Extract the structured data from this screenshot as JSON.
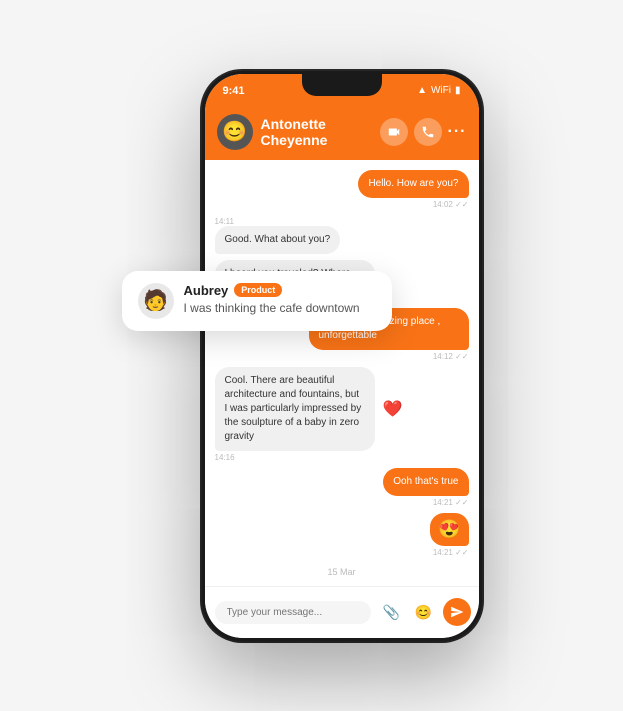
{
  "status_bar": {
    "time": "9:41",
    "signal": "●●●",
    "wifi": "▲",
    "battery": "▮"
  },
  "header": {
    "name": "Antonette Cheyenne",
    "avatar_emoji": "😊",
    "video_icon": "video",
    "phone_icon": "phone",
    "more_label": "···"
  },
  "messages": [
    {
      "id": 1,
      "type": "sent",
      "text": "Hello. How are you?",
      "time": "14:02",
      "read": true
    },
    {
      "id": 2,
      "type": "received",
      "text": "Good. What about you?",
      "time": "14:11"
    },
    {
      "id": 3,
      "type": "received",
      "text": "I heard you traveled? Where did you go this time?",
      "time": ""
    },
    {
      "id": 4,
      "type": "sent",
      "text": "Singapore. Amazing place , unforgettable",
      "time": "14:12",
      "read": true
    },
    {
      "id": 5,
      "type": "received",
      "text": "Cool. There are beautiful architecture and fountains, but I was particularly impressed by the soulpture of a baby in zero gravity",
      "time": "14:16",
      "has_heart": true
    },
    {
      "id": 6,
      "type": "sent",
      "text": "Ooh that's true",
      "time": "14:21",
      "read": true
    },
    {
      "id": 7,
      "type": "sent",
      "text": "😍",
      "time": "14:21",
      "read": true
    },
    {
      "id": 8,
      "type": "date",
      "text": "15 Mar"
    }
  ],
  "input": {
    "placeholder": "Type your message...",
    "attach_icon": "📎",
    "emoji_icon": "😊",
    "send_icon": "➤"
  },
  "notification": {
    "avatar_emoji": "🧑",
    "name": "Aubrey",
    "badge": "Product",
    "message": "I was thinking the cafe downtown"
  }
}
